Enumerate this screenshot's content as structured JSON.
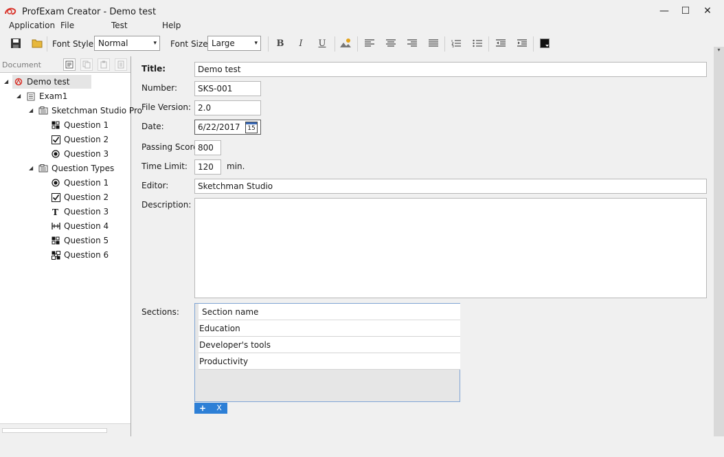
{
  "window": {
    "title": "ProfExam Creator - Demo test",
    "minimize": "—",
    "maximize": "☐",
    "close": "✕"
  },
  "menu": [
    "Application",
    "File",
    "Test",
    "Help"
  ],
  "toolbar": {
    "font_style_label": "Font Style:",
    "font_style_value": "Normal",
    "font_size_label": "Font Size:",
    "font_size_value": "Large",
    "bold": "B",
    "italic": "I",
    "underline": "U",
    "dropdown_arrow": "▾"
  },
  "document_panel": {
    "title": "Document",
    "tree": [
      {
        "label": "Demo test",
        "arrow": "◢",
        "icon": "exam-logo-icon",
        "level": 0
      },
      {
        "label": "Exam1",
        "arrow": "◢",
        "icon": "exam-icon",
        "level": 1
      },
      {
        "label": "Sketchman Studio Pro",
        "arrow": "◢",
        "icon": "section-icon",
        "level": 2
      },
      {
        "label": "Question 1",
        "icon": "drag-drop-icon",
        "level": 3
      },
      {
        "label": "Question 2",
        "icon": "checkbox-icon",
        "level": 3
      },
      {
        "label": "Question 3",
        "icon": "radio-icon",
        "level": 3
      },
      {
        "label": "Question Types",
        "arrow": "◢",
        "icon": "section-icon",
        "level": 2
      },
      {
        "label": "Question 1",
        "icon": "radio-icon",
        "level": 3
      },
      {
        "label": "Question 2",
        "icon": "checkbox-icon",
        "level": 3
      },
      {
        "label": "Question 3",
        "icon": "text-icon",
        "level": 3
      },
      {
        "label": "Question 4",
        "icon": "fill-in-icon",
        "level": 3
      },
      {
        "label": "Question 5",
        "icon": "drag-drop-icon",
        "level": 3
      },
      {
        "label": "Question 6",
        "icon": "hotspot-icon",
        "level": 3
      }
    ]
  },
  "form": {
    "title_label": "Title:",
    "title_value": "Demo test",
    "number_label": "Number:",
    "number_value": "SKS-001",
    "version_label": "File Version:",
    "version_value": "2.0",
    "date_label": "Date:",
    "date_value": "6/22/2017",
    "calendar_day": "15",
    "passing_label": "Passing Score:",
    "passing_value": "800",
    "time_label": "Time Limit:",
    "time_value": "120",
    "time_unit": "min.",
    "editor_label": "Editor:",
    "editor_value": "Sketchman Studio",
    "description_label": "Description:",
    "description_value": "",
    "sections_label": "Sections:"
  },
  "sections": {
    "header": "Section name",
    "rows": [
      "Education",
      "Developer's tools",
      "Productivity"
    ],
    "add": "+",
    "remove": "X"
  },
  "colors": {
    "accent": "#2d7fd6",
    "logo": "#d9342b"
  }
}
